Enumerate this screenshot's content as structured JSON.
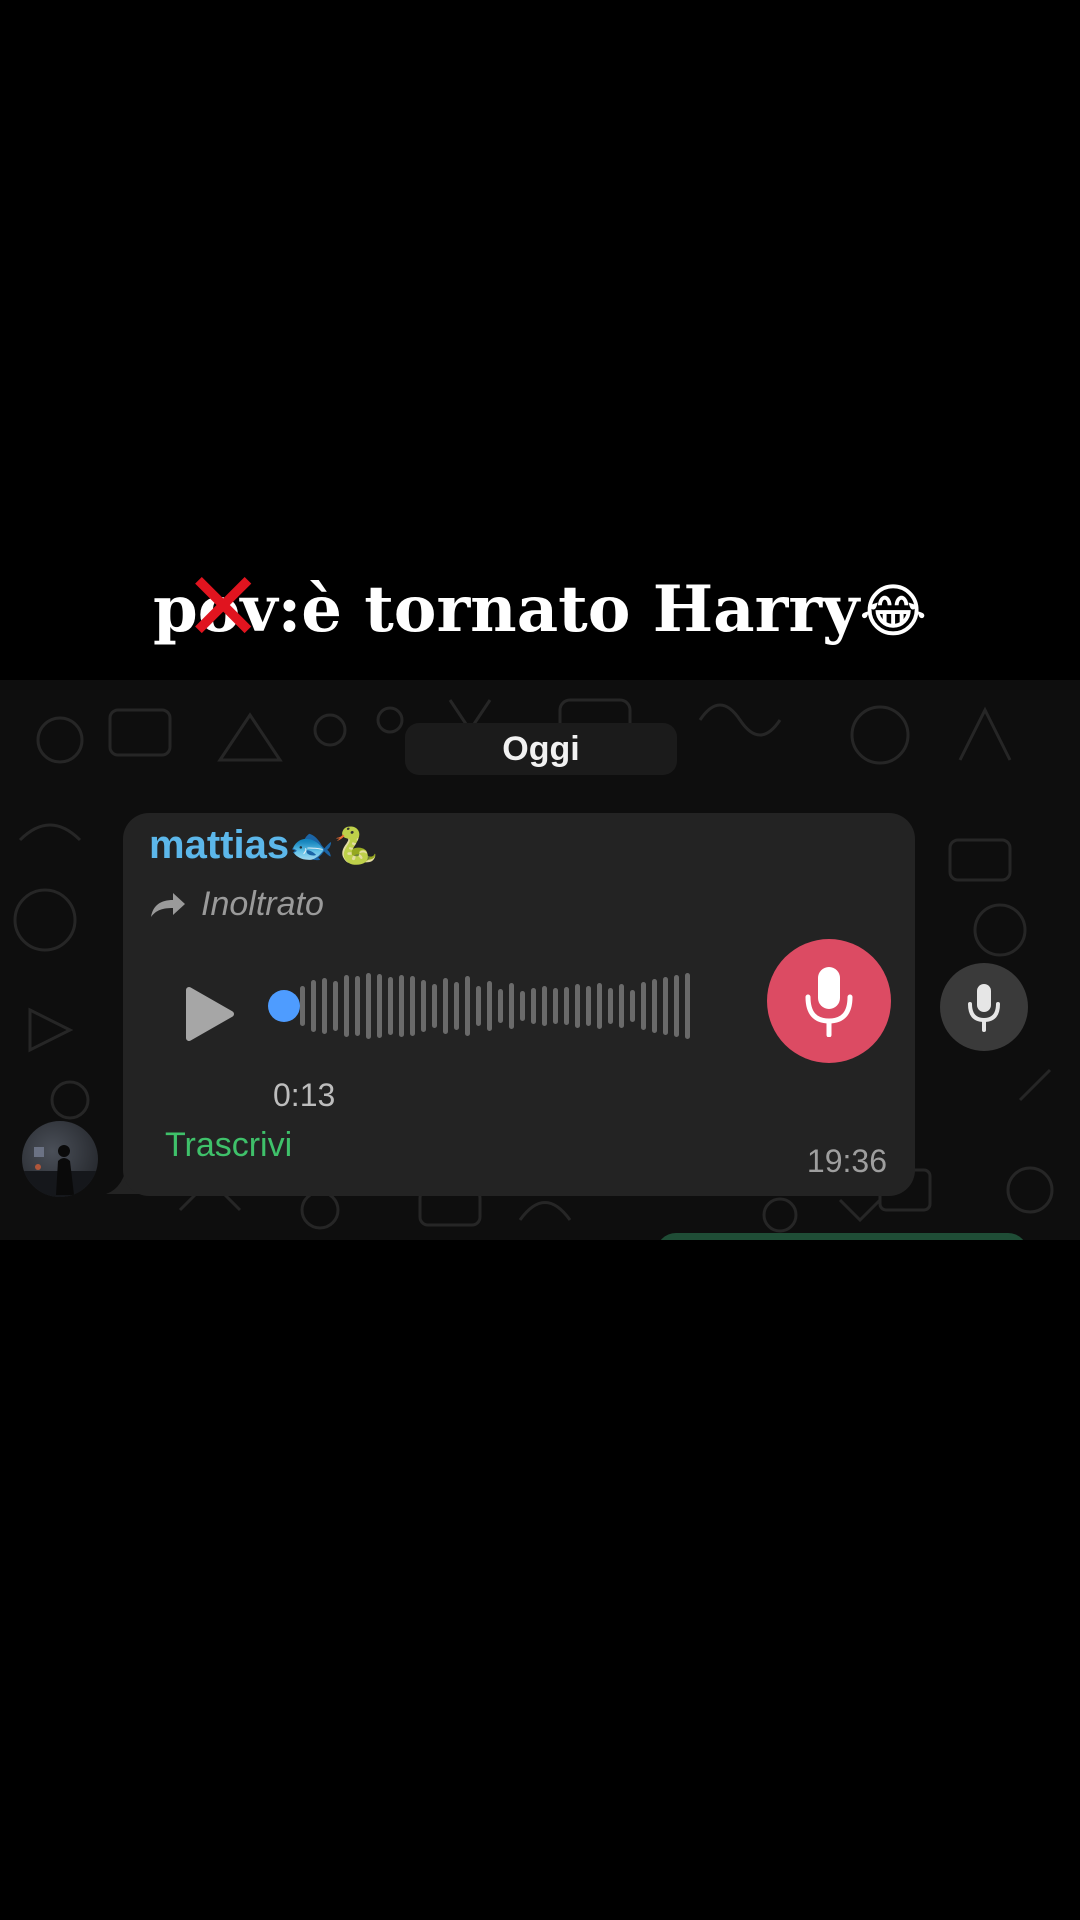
{
  "caption": {
    "struck_text": "pov",
    "text": ":è tornato Harry",
    "emoji": "😂"
  },
  "chat": {
    "day_label": "Oggi",
    "message": {
      "sender_name": "mattias",
      "sender_emojis": "🐟🐍",
      "forwarded_label": "Inoltrato",
      "voice_duration": "0:13",
      "transcribe_label": "Trascrivi",
      "timestamp": "19:36",
      "playback_progress": 0.0
    }
  },
  "colors": {
    "sender": "#5cb7ea",
    "transcribe": "#3fc16a",
    "mic_accent": "#dc4b63",
    "progress_dot": "#4e9cff"
  },
  "icons": [
    "forward-arrow-icon",
    "play-icon",
    "microphone-icon",
    "cross-mark-icon"
  ]
}
